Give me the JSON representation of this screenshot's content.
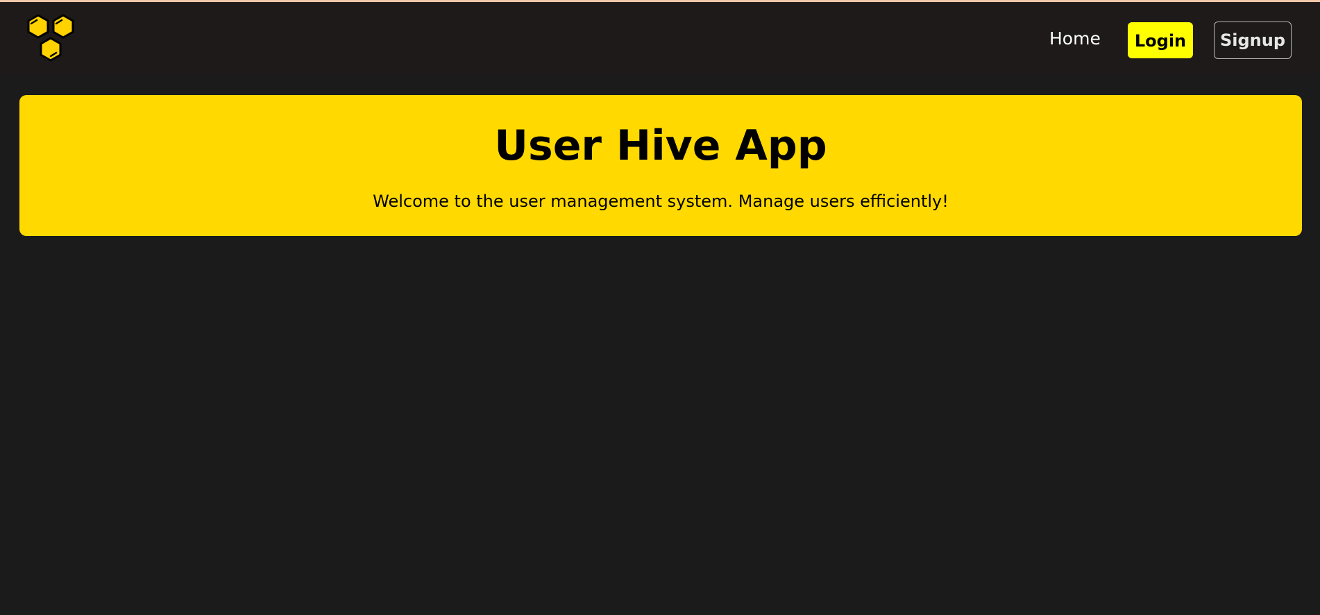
{
  "colors": {
    "page_background": "#1b1b1b",
    "navbar_background": "#1e1a1a",
    "accent_yellow": "#ffd900",
    "login_yellow": "#ffff00",
    "top_accent": "#f0c8a8"
  },
  "navbar": {
    "logo_icon": "honeycomb-logo-icon",
    "links": {
      "home_label": "Home"
    },
    "login_label": "Login",
    "signup_label": "Signup"
  },
  "hero": {
    "title": "User Hive App",
    "subtitle": "Welcome to the user management system. Manage users efficiently!"
  }
}
